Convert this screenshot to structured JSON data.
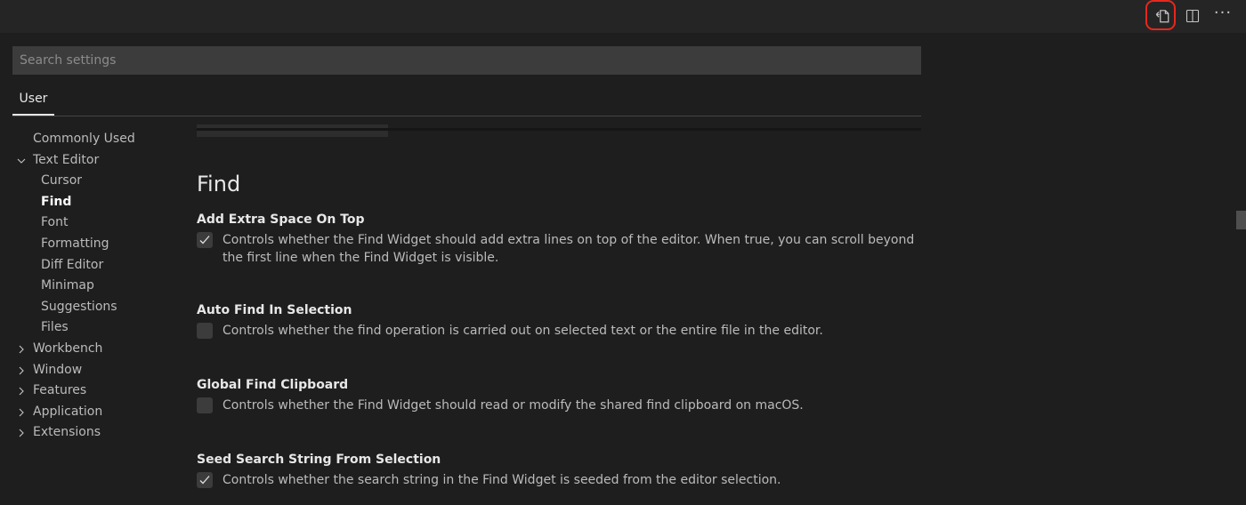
{
  "toolbar": {
    "actions": [
      {
        "icon": "open-settings-json-icon",
        "highlighted": true
      },
      {
        "icon": "split-editor-icon"
      },
      {
        "icon": "more-actions-icon",
        "glyph": "···"
      }
    ],
    "highlight_color": "#e8271c"
  },
  "search": {
    "placeholder": "Search settings"
  },
  "scope": {
    "active_tab": "User"
  },
  "toc": {
    "items": [
      {
        "label": "Commonly Used"
      },
      {
        "label": "Text Editor",
        "expanded": true
      },
      {
        "label": "Cursor"
      },
      {
        "label": "Find",
        "active": true
      },
      {
        "label": "Font"
      },
      {
        "label": "Formatting"
      },
      {
        "label": "Diff Editor"
      },
      {
        "label": "Minimap"
      },
      {
        "label": "Suggestions"
      },
      {
        "label": "Files"
      },
      {
        "label": "Workbench",
        "expanded": false
      },
      {
        "label": "Window",
        "expanded": false
      },
      {
        "label": "Features",
        "expanded": false
      },
      {
        "label": "Application",
        "expanded": false
      },
      {
        "label": "Extensions",
        "expanded": false
      }
    ]
  },
  "section": {
    "title": "Find",
    "settings": [
      {
        "title": "Add Extra Space On Top",
        "checked": true,
        "description": "Controls whether the Find Widget should add extra lines on top of the editor. When true, you can scroll beyond the first line when the Find Widget is visible."
      },
      {
        "title": "Auto Find In Selection",
        "checked": false,
        "description": "Controls whether the find operation is carried out on selected text or the entire file in the editor."
      },
      {
        "title": "Global Find Clipboard",
        "checked": false,
        "description": "Controls whether the Find Widget should read or modify the shared find clipboard on macOS."
      },
      {
        "title": "Seed Search String From Selection",
        "checked": true,
        "description": "Controls whether the search string in the Find Widget is seeded from the editor selection."
      }
    ]
  },
  "colors": {
    "background": "#1e1e1e",
    "title_bar": "#252526",
    "input_background": "#3c3c3c",
    "active_text": "#ffffff"
  }
}
